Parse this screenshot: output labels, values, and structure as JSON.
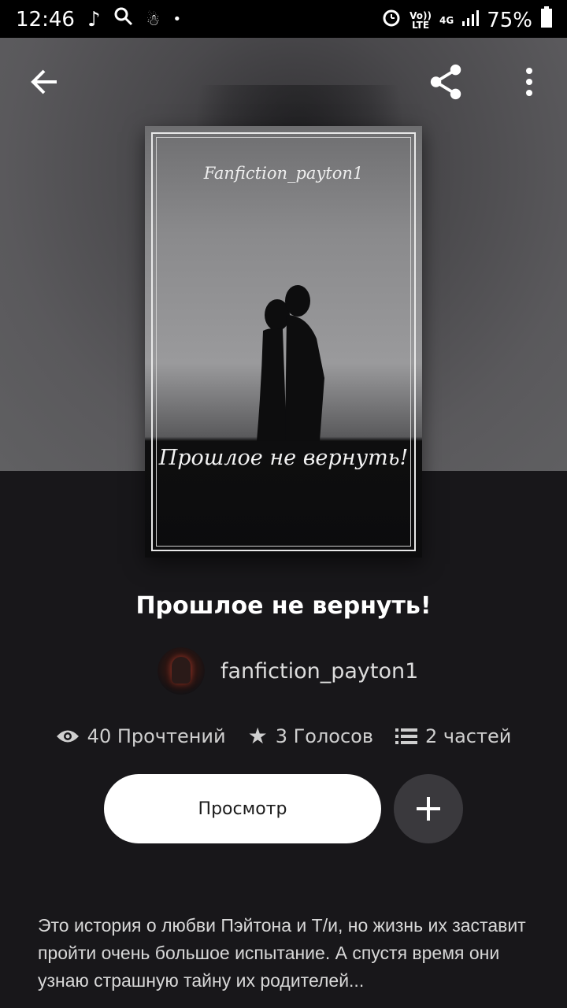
{
  "status_bar": {
    "time": "12:46",
    "volte": "Vo)) LTE",
    "network": "4G",
    "battery": "75%"
  },
  "toolbar": {
    "back_icon": "arrow-left-icon",
    "share_icon": "share-icon",
    "more_icon": "more-vertical-icon"
  },
  "cover": {
    "author_text": "Fanfiction_payton1",
    "title_text": "Прошлое не вернуть!"
  },
  "story": {
    "title": "Прошлое не вернуть!",
    "author": "fanfiction_payton1",
    "reads": "40 Прочтений",
    "votes": "3 Голосов",
    "parts": "2 частей",
    "read_button": "Просмотр",
    "description": "Это история о любви Пэйтона и Т/и, но жизнь их заставит пройти очень большое испытание. А спустя время они узнаю страшную тайну их родителей..."
  },
  "colors": {
    "background": "#18171a",
    "button_primary": "#ffffff",
    "button_secondary": "#3a393d"
  }
}
